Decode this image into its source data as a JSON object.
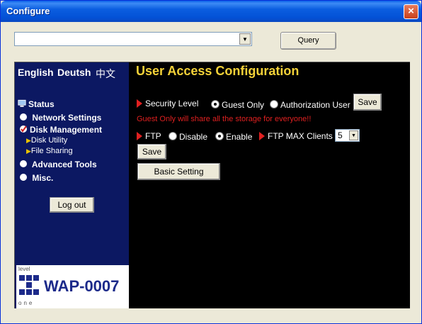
{
  "window": {
    "title": "Configure",
    "close_label": "×"
  },
  "top": {
    "dropdown_value": "",
    "query_label": "Query"
  },
  "languages": [
    "English",
    "Deutsh",
    "中文"
  ],
  "nav": {
    "status": "Status",
    "network_settings": "Network Settings",
    "disk_management": "Disk Management",
    "disk_utility": "Disk Utility",
    "file_sharing": "File Sharing",
    "advanced_tools": "Advanced Tools",
    "misc": "Misc.",
    "logout": "Log out"
  },
  "logo": {
    "level": "level",
    "one": "one",
    "model": "WAP-0007"
  },
  "main": {
    "heading": "User Access Configuration",
    "security_level_label": "Security Level",
    "security_options": [
      {
        "label": "Guest Only",
        "selected": true
      },
      {
        "label": "Authorization User",
        "selected": false
      }
    ],
    "save_label": "Save",
    "note": "Guest Only will share all the storage for everyone!!",
    "ftp_label": "FTP",
    "ftp_options": [
      {
        "label": "Disable",
        "selected": false
      },
      {
        "label": "Enable",
        "selected": true
      }
    ],
    "ftp_max_clients_label": "FTP MAX Clients",
    "ftp_max_clients_value": "5",
    "save2_label": "Save",
    "basic_setting_label": "Basic Setting"
  },
  "colors": {
    "sidebar_bg": "#0c1862",
    "heading": "#f4d238",
    "alert": "#e02020",
    "titlebar": "#0351d6"
  }
}
